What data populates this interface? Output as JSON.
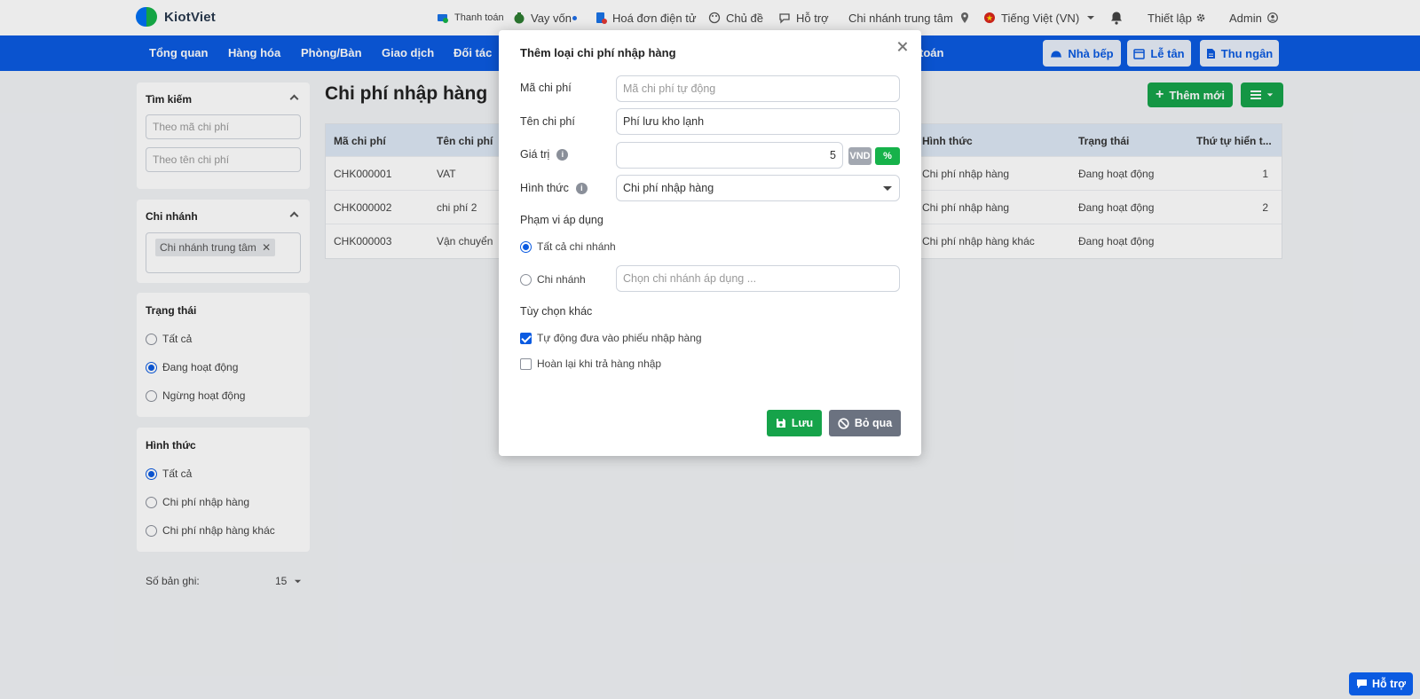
{
  "brand": {
    "name": "KiotViet"
  },
  "topbar": {
    "links": [
      {
        "label": "Thanh toán",
        "icon": "payment-icon"
      },
      {
        "label": "Vay vốn",
        "icon": "money-bag-icon"
      },
      {
        "label": "Hoá đơn điện tử",
        "icon": "invoice-icon"
      },
      {
        "label": "Chủ đề",
        "icon": "palette-icon"
      },
      {
        "label": "Hỗ trợ",
        "icon": "chat-icon"
      }
    ],
    "branch": "Chi nhánh trung tâm",
    "language": "Tiếng Việt (VN)",
    "settings": "Thiết lập",
    "user": "Admin"
  },
  "mainnav": {
    "items": [
      "Tổng quan",
      "Hàng hóa",
      "Phòng/Bàn",
      "Giao dịch",
      "Đối tác"
    ],
    "hidden_fragment": "toán",
    "buttons": [
      "Nhà bếp",
      "Lễ tân",
      "Thu ngân"
    ]
  },
  "sidebar": {
    "search": {
      "title": "Tìm kiếm",
      "code_placeholder": "Theo mã chi phí",
      "name_placeholder": "Theo tên chi phí"
    },
    "branch": {
      "title": "Chi nhánh",
      "tag": "Chi nhánh trung tâm"
    },
    "status": {
      "title": "Trạng thái",
      "options": [
        "Tất cả",
        "Đang hoạt động",
        "Ngừng hoạt động"
      ],
      "selected": 1
    },
    "form": {
      "title": "Hình thức",
      "options": [
        "Tất cả",
        "Chi phí nhập hàng",
        "Chi phí nhập hàng khác"
      ],
      "selected": 0
    },
    "records": {
      "label": "Số bản ghi:",
      "value": "15"
    }
  },
  "main": {
    "title": "Chi phí nhập hàng",
    "add_button": "Thêm mới",
    "table": {
      "columns": [
        "Mã chi phí",
        "Tên chi phí",
        "Hình thức",
        "Trạng thái",
        "Thứ tự hiển t..."
      ],
      "rows": [
        [
          "CHK000001",
          "VAT",
          "Chi phí nhập hàng",
          "Đang hoạt động",
          "1"
        ],
        [
          "CHK000002",
          "chi phí 2",
          "Chi phí nhập hàng",
          "Đang hoạt động",
          "2"
        ],
        [
          "CHK000003",
          "Vận chuyển",
          "Chi phí nhập hàng khác",
          "Đang hoạt động",
          ""
        ]
      ]
    }
  },
  "modal": {
    "title": "Thêm loại chi phí nhập hàng",
    "code_label": "Mã chi phí",
    "code_placeholder": "Mã chi phí tự động",
    "name_label": "Tên chi phí",
    "name_value": "Phí lưu kho lạnh",
    "value_label": "Giá trị",
    "value_value": "5",
    "unit_vnd": "VND",
    "unit_percent": "%",
    "form_label": "Hình thức",
    "form_value": "Chi phí nhập hàng",
    "scope_label": "Phạm vi áp dụng",
    "scope_all": "Tất cả chi nhánh",
    "scope_branch": "Chi nhánh",
    "scope_branch_placeholder": "Chọn chi nhánh áp dụng ...",
    "other_label": "Tùy chọn khác",
    "opt_auto": "Tự động đưa vào phiếu nhập hàng",
    "opt_refund": "Hoàn lại khi trả hàng nhập",
    "save": "Lưu",
    "skip": "Bỏ qua"
  },
  "help_float": "Hỗ trợ",
  "colors": {
    "primary_blue": "#0b5be1",
    "green": "#16a34a",
    "gray_button": "#6b7280"
  }
}
